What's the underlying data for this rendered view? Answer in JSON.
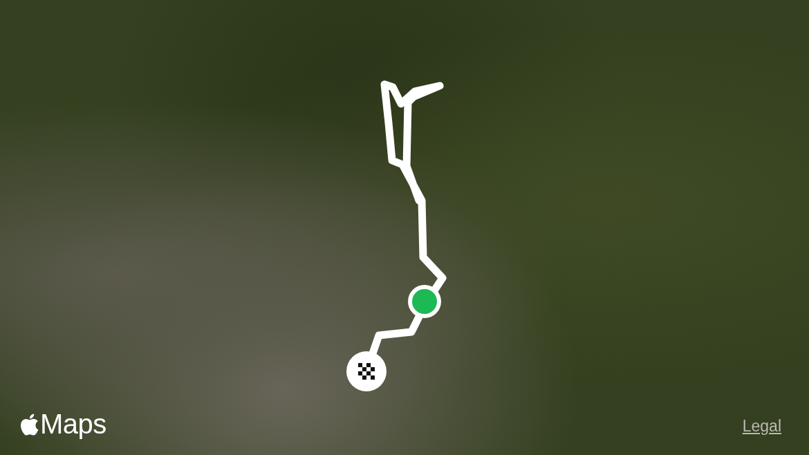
{
  "map": {
    "logo_text": "Maps",
    "legal_link": "Legal"
  }
}
